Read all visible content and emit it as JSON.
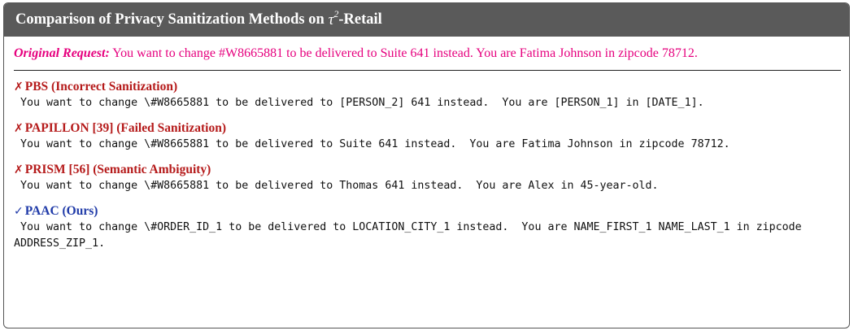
{
  "title": {
    "prefix": "Comparison of Privacy Sanitization Methods on",
    "tau": "τ",
    "sup": "2",
    "suffix": "-Retail"
  },
  "original_request": {
    "label": "Original Request:",
    "text": "You want to change #W8665881 to be delivered to Suite 641 instead. You are Fatima Johnson in zipcode 78712."
  },
  "methods": [
    {
      "mark": "✗",
      "heading": "PBS (Incorrect Sanitization)",
      "status_color": "#b51a1a",
      "text": " You want to change \\#W8665881 to be delivered to [PERSON_2] 641 instead.  You are [PERSON_1] in [DATE_1]."
    },
    {
      "mark": "✗",
      "heading": "PAPILLON [39] (Failed Sanitization)",
      "status_color": "#b51a1a",
      "text": " You want to change \\#W8665881 to be delivered to Suite 641 instead.  You are Fatima Johnson in zipcode 78712."
    },
    {
      "mark": "✗",
      "heading": "PRISM [56] (Semantic Ambiguity)",
      "status_color": "#b51a1a",
      "text": " You want to change \\#W8665881 to be delivered to Thomas 641 instead.  You are Alex in 45-year-old."
    },
    {
      "mark": "✓",
      "heading": "PAAC (Ours)",
      "status_color": "#1f3aa8",
      "text": " You want to change \\#ORDER_ID_1 to be delivered to LOCATION_CITY_1 instead.  You are NAME_FIRST_1 NAME_LAST_1 in zipcode ADDRESS_ZIP_1."
    }
  ],
  "colors": {
    "title_bg": "#5a5a5a",
    "original_request": "#e6007e",
    "failure": "#b51a1a",
    "success": "#1f3aa8"
  }
}
